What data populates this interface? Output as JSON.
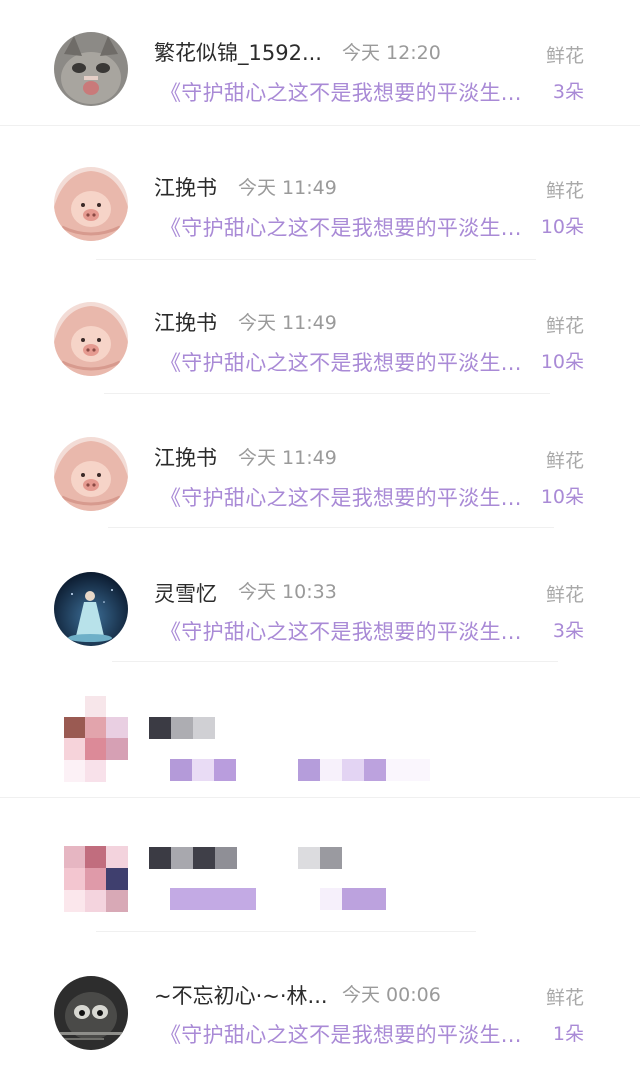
{
  "colors": {
    "accent_purple": "#a98ad6",
    "name_text": "#2b2b2b",
    "meta_gray": "#9a9a9a"
  },
  "records": [
    {
      "name": "繁花似锦_1592...",
      "time": "今天 12:20",
      "gift": "鲜花",
      "book": "《守护甜心之这不是我想要的平淡生...",
      "count": "3朵",
      "avatar": "cat-avatar"
    },
    {
      "name": "江挽书",
      "time": "今天 11:49",
      "gift": "鲜花",
      "book": "《守护甜心之这不是我想要的平淡生...",
      "count": "10朵",
      "avatar": "pig-avatar"
    },
    {
      "name": "江挽书",
      "time": "今天 11:49",
      "gift": "鲜花",
      "book": "《守护甜心之这不是我想要的平淡生...",
      "count": "10朵",
      "avatar": "pig-avatar"
    },
    {
      "name": "江挽书",
      "time": "今天 11:49",
      "gift": "鲜花",
      "book": "《守护甜心之这不是我想要的平淡生...",
      "count": "10朵",
      "avatar": "pig-avatar"
    },
    {
      "name": "灵雪忆",
      "time": "今天 10:33",
      "gift": "鲜花",
      "book": "《守护甜心之这不是我想要的平淡生...",
      "count": "3朵",
      "avatar": "fairy-avatar"
    },
    {
      "name": "",
      "time": "",
      "gift": "",
      "book": "",
      "count": "",
      "avatar": "pixelated-avatar"
    },
    {
      "name": "",
      "time": "",
      "gift": "",
      "book": "",
      "count": "",
      "avatar": "pixelated-avatar"
    },
    {
      "name": "~不忘初心·~·林...",
      "time": "今天 00:06",
      "gift": "鲜花",
      "book": "《守护甜心之这不是我想要的平淡生...",
      "count": "1朵",
      "avatar": "dark-avatar"
    }
  ]
}
